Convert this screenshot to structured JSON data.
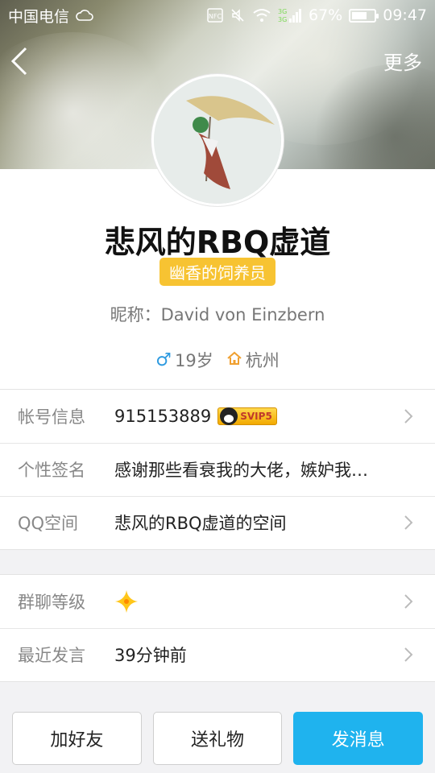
{
  "status_bar": {
    "carrier": "中国电信",
    "battery": "67%",
    "time": "09:47",
    "network": "3G",
    "icons": [
      "cloud-icon",
      "nfc-icon",
      "mute-icon",
      "wifi-icon",
      "signal-icon",
      "battery-icon"
    ]
  },
  "nav": {
    "more_label": "更多"
  },
  "profile": {
    "name": "悲风的RBQ虚道",
    "badge": "幽香的饲养员",
    "nickname": "昵称：David von Einzbern",
    "age": "19岁",
    "location": "杭州"
  },
  "info_list": {
    "account_label": "帐号信息",
    "account_value": "915153889",
    "svip_label": "SVIP5",
    "signature_label": "个性签名",
    "signature_value": "感谢那些看衰我的大佬，嫉妒我…",
    "qzone_label": "QQ空间",
    "qzone_value": "悲风的RBQ虚道的空间"
  },
  "group_list": {
    "level_label": "群聊等级",
    "recent_label": "最近发言",
    "recent_value": "39分钟前"
  },
  "actions": {
    "add_friend": "加好友",
    "send_gift": "送礼物",
    "send_message": "发消息"
  },
  "colors": {
    "accent_blue": "#1fb3ee",
    "badge_yellow": "#f7c332",
    "male_blue": "#2f9be0",
    "home_orange": "#f0a030"
  }
}
